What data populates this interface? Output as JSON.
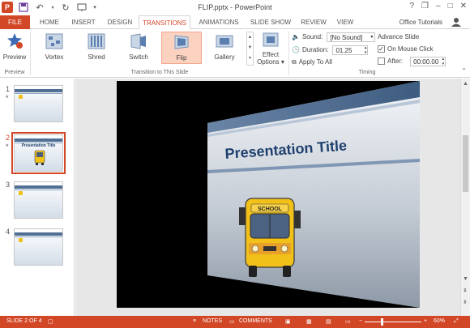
{
  "window": {
    "title": "FLIP.pptx - PowerPoint",
    "controls": [
      "?",
      "❐",
      "–",
      "□",
      "✕"
    ]
  },
  "tabs": [
    {
      "label": "FILE"
    },
    {
      "label": "HOME"
    },
    {
      "label": "INSERT"
    },
    {
      "label": "DESIGN"
    },
    {
      "label": "TRANSITIONS"
    },
    {
      "label": "ANIMATIONS"
    },
    {
      "label": "SLIDE SHOW"
    },
    {
      "label": "REVIEW"
    },
    {
      "label": "VIEW"
    }
  ],
  "account": {
    "name": "Office Tutorials"
  },
  "ribbon": {
    "preview": {
      "label": "Preview",
      "group": "Preview"
    },
    "transitions": [
      {
        "label": "Vortex",
        "icon": "vortex-icon"
      },
      {
        "label": "Shred",
        "icon": "shred-icon"
      },
      {
        "label": "Switch",
        "icon": "switch-icon"
      },
      {
        "label": "Flip",
        "icon": "flip-icon",
        "selected": true
      },
      {
        "label": "Gallery",
        "icon": "gallery-icon"
      }
    ],
    "transitions_group": "Transition to This Slide",
    "effect_options": {
      "line1": "Effect",
      "line2": "Options"
    },
    "timing": {
      "sound_label": "Sound:",
      "sound_value": "[No Sound]",
      "duration_label": "Duration:",
      "duration_value": "01.25",
      "apply_all": "Apply To All",
      "advance_label": "Advance Slide",
      "on_click_label": "On Mouse Click",
      "on_click_checked": true,
      "after_label": "After:",
      "after_value": "00:00.00",
      "after_checked": false,
      "group": "Timing"
    }
  },
  "slides": [
    {
      "num": "1",
      "star": "*"
    },
    {
      "num": "2",
      "star": "*",
      "title": "Presentation Title",
      "selected": true
    },
    {
      "num": "3"
    },
    {
      "num": "4"
    }
  ],
  "main_slide": {
    "title": "Presentation Title",
    "bus_sign": "SCHOOL"
  },
  "status": {
    "slide_info": "SLIDE 2 OF 4",
    "notes": "NOTES",
    "comments": "COMMENTS",
    "zoom": "60%",
    "zoom_fraction": 0.6
  },
  "colors": {
    "accent": "#d24726",
    "selected_transition": "#fbd1c0",
    "slide_band": "#516f94",
    "title_text": "#1f3f6e"
  }
}
